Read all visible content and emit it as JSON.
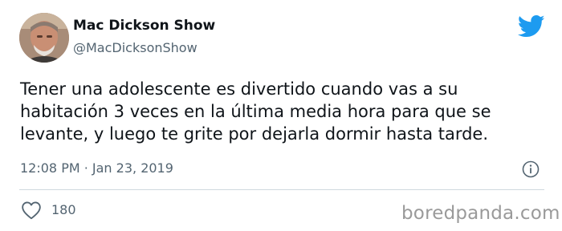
{
  "author": {
    "name": "Mac Dickson Show",
    "handle": "@MacDicksonShow",
    "avatar_icon": "person-photo-avatar"
  },
  "brand": {
    "icon": "twitter-bird-icon",
    "color": "#1d9bf0"
  },
  "tweet": {
    "lines": [
      "Tener una adolescente es divertido cuando vas a su",
      "habitación 3 veces en la última media hora para que se",
      "levante, y luego te grite por dejarla dormir hasta tarde."
    ]
  },
  "meta": {
    "timestamp": "12:08 PM · Jan 23, 2019",
    "info_icon": "info-icon"
  },
  "actions": {
    "like_icon": "heart-icon",
    "like_count": "180"
  },
  "watermark": "boredpanda.com"
}
